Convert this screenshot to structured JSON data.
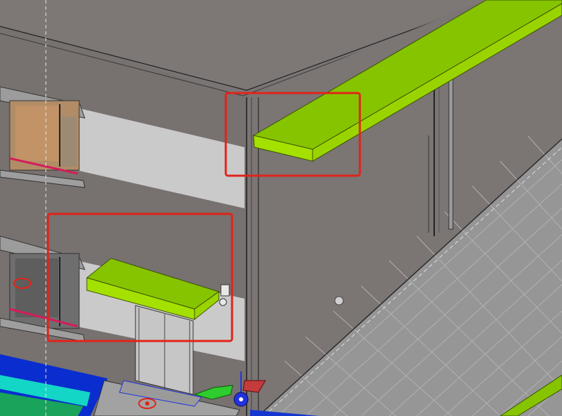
{
  "viewport": {
    "title": "",
    "colors": {
      "wall": "#77716f",
      "wall_front": "#7b7574",
      "roof": "#7a7574",
      "light_band": "#c9c9c9",
      "ground": "#959595",
      "grid_line": "#b4b4b4",
      "canopy": "#86c400",
      "canopy_edge": "#a4e000",
      "highlight_box": "#e2231a",
      "water": "#0a2dcf",
      "window_frame": "#d41c5a"
    },
    "highlights": [
      {
        "label": "upper-canopy-highlight"
      },
      {
        "label": "entrance-canopy-highlight"
      }
    ],
    "gizmo": {
      "x_axis_color": "#c43b3b",
      "y_axis_color": "#2ecc2e",
      "z_axis_color": "#2233dd"
    }
  }
}
